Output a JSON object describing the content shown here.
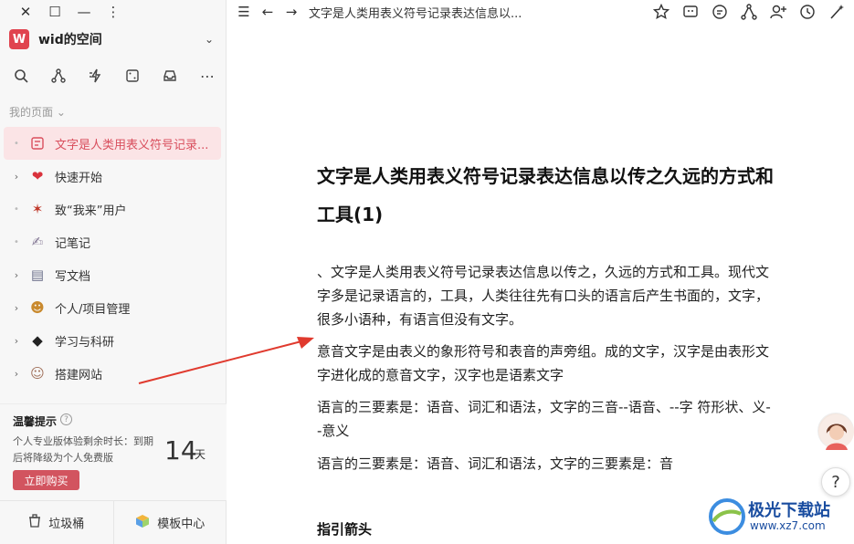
{
  "sidebar": {
    "workspace": {
      "avatar_letter": "W",
      "name": "wid的空间"
    },
    "section_label": "我的页面",
    "items": [
      {
        "label": "文字是人类用表义符号记录...",
        "icon": "doc-icon",
        "has_children": false,
        "active": true
      },
      {
        "label": "快速开始",
        "icon": "heart-icon",
        "has_children": true,
        "active": false
      },
      {
        "label": "致“我来”用户",
        "icon": "party-icon",
        "has_children": false,
        "active": false
      },
      {
        "label": "记笔记",
        "icon": "pen-icon",
        "has_children": false,
        "active": false
      },
      {
        "label": "写文档",
        "icon": "document-icon",
        "has_children": true,
        "active": false
      },
      {
        "label": "个人/项目管理",
        "icon": "worker-icon",
        "has_children": true,
        "active": false
      },
      {
        "label": "学习与科研",
        "icon": "graduation-cap-icon",
        "has_children": true,
        "active": false
      },
      {
        "label": "搭建网站",
        "icon": "person-icon",
        "has_children": true,
        "active": false
      }
    ],
    "tip": {
      "title": "温馨提示",
      "text": "个人专业版体验剩余时长：到期后将降级为个人免费版",
      "days": "14",
      "unit": "天",
      "buy_label": "立即购买"
    },
    "bottom": {
      "trash_label": "垃圾桶",
      "templates_label": "模板中心"
    }
  },
  "topbar": {
    "doc_title": "文字是人类用表义符号记录表达信息以..."
  },
  "doc": {
    "title": "文字是人类用表义符号记录表达信息以传之久远的方式和工具(1)",
    "p1": "、文字是人类用表义符号记录表达信息以传之，久远的方式和工具。现代文字多是记录语言的，工具，人类往往先有口头的语言后产生书面的，文字，很多小语种，有语言但没有文字。",
    "p2": "意音文字是由表义的象形符号和表音的声旁组。成的文字，汉字是由表形文字进化成的意音文字，汉字也是语素文字",
    "p3": "语言的三要素是：语音、词汇和语法，文字的三音--语音、--字 符形状、义--意义",
    "p4": "语言的三要素是：语音、词汇和语法，文字的三要素是：音",
    "h3": "指引箭头"
  },
  "watermark": {
    "text": "极光下载站",
    "url": "www.xz7.com"
  },
  "colors": {
    "accent": "#d94e5d",
    "active_bg": "#fbe4e6",
    "arrow": "#e03a2e"
  }
}
